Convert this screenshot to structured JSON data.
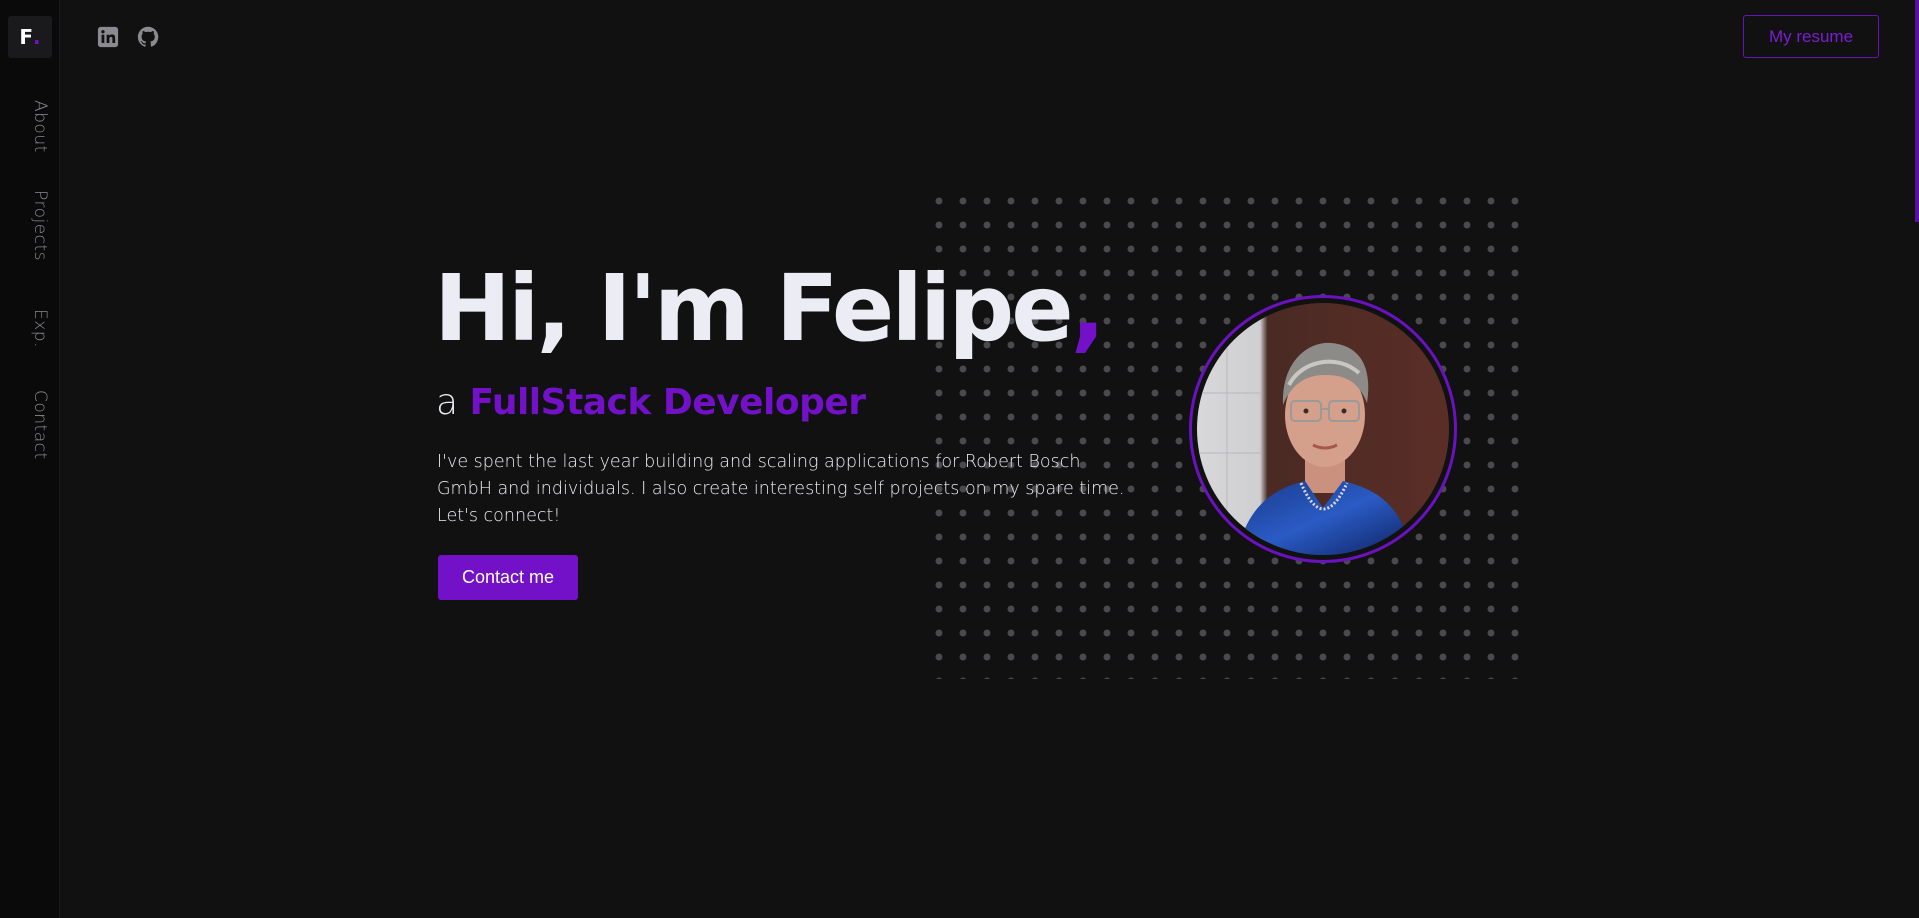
{
  "brand": {
    "logo_letter": "F",
    "logo_dot": ".",
    "accent_color": "#7211c7"
  },
  "sidebar": {
    "items": [
      {
        "label": "About"
      },
      {
        "label": "Projects"
      },
      {
        "label": "Exp."
      },
      {
        "label": "Contact"
      }
    ]
  },
  "topbar": {
    "icons": [
      "linkedin-icon",
      "github-icon"
    ],
    "resume_label": "My resume"
  },
  "hero": {
    "title": "Hi, I'm Felipe",
    "title_comma": ",",
    "subtitle_prefix": "a",
    "subtitle_role": "FullStack Developer",
    "intro_line1": "I've spent the last year building and scaling applications for Robert Bosch",
    "intro_line2": "GmbH and individuals. I also create interesting self projects on my spare time.",
    "intro_line3": "Let's connect!",
    "cta_label": "Contact me"
  }
}
